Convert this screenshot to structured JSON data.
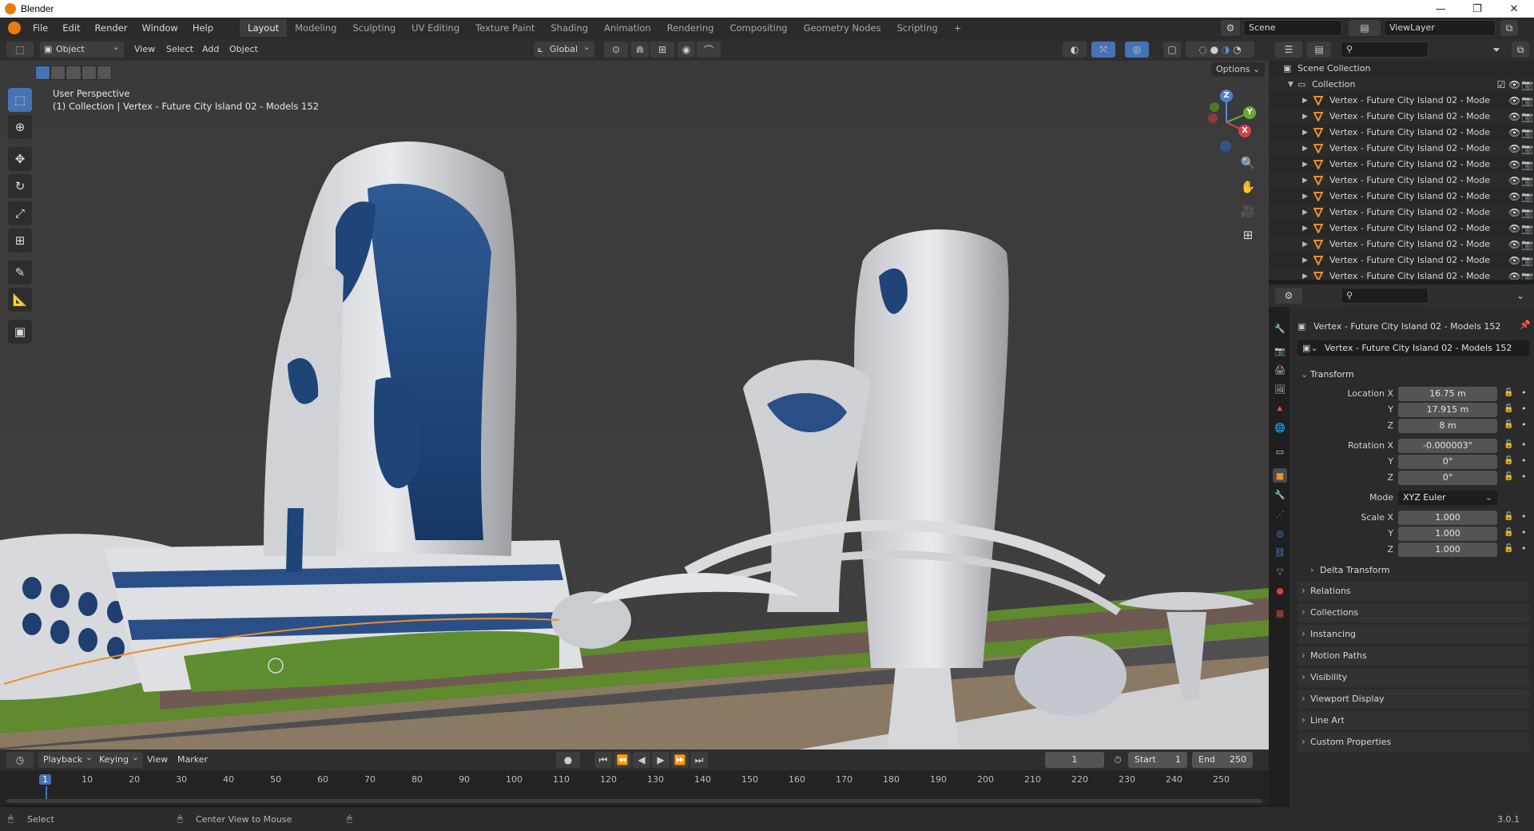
{
  "window": {
    "title": "Blender"
  },
  "menu": {
    "items": [
      "File",
      "Edit",
      "Render",
      "Window",
      "Help"
    ]
  },
  "workspaces": {
    "tabs": [
      "Layout",
      "Modeling",
      "Sculpting",
      "UV Editing",
      "Texture Paint",
      "Shading",
      "Animation",
      "Rendering",
      "Compositing",
      "Geometry Nodes",
      "Scripting"
    ],
    "active": "Layout",
    "add_label": "+"
  },
  "scene": {
    "name": "Scene",
    "view_layer": "ViewLayer"
  },
  "viewport_header": {
    "mode": "Object Mode",
    "menus": [
      "View",
      "Select",
      "Add",
      "Object"
    ],
    "orientation": "Global",
    "options_label": "Options"
  },
  "viewport": {
    "overlay_title": "User Perspective",
    "overlay_subtitle": "(1) Collection | Vertex - Future City Island 02 - Models 152",
    "gizmo": {
      "z": "Z",
      "y": "Y",
      "x": "X"
    }
  },
  "outliner": {
    "scene_collection": "Scene Collection",
    "collection": "Collection",
    "items": [
      "Vertex - Future City Island 02 - Mode",
      "Vertex - Future City Island 02 - Mode",
      "Vertex - Future City Island 02 - Mode",
      "Vertex - Future City Island 02 - Mode",
      "Vertex - Future City Island 02 - Mode",
      "Vertex - Future City Island 02 - Mode",
      "Vertex - Future City Island 02 - Mode",
      "Vertex - Future City Island 02 - Mode",
      "Vertex - Future City Island 02 - Mode",
      "Vertex - Future City Island 02 - Mode",
      "Vertex - Future City Island 02 - Mode",
      "Vertex - Future City Island 02 - Mode"
    ]
  },
  "properties": {
    "object_name": "Vertex - Future City Island 02 - Models 152",
    "object_field": "Vertex - Future City Island 02 - Models 152",
    "transform_label": "Transform",
    "location_label": "Location X",
    "y_label": "Y",
    "z_label": "Z",
    "location": {
      "x": "16.75 m",
      "y": "17.915 m",
      "z": "8 m"
    },
    "rotation_label": "Rotation X",
    "rotation": {
      "x": "-0.000003°",
      "y": "0°",
      "z": "0°"
    },
    "mode_label": "Mode",
    "mode_value": "XYZ Euler",
    "scale_label": "Scale X",
    "scale": {
      "x": "1.000",
      "y": "1.000",
      "z": "1.000"
    },
    "delta_transform": "Delta Transform",
    "panels": [
      "Relations",
      "Collections",
      "Instancing",
      "Motion Paths",
      "Visibility",
      "Viewport Display",
      "Line Art",
      "Custom Properties"
    ]
  },
  "timeline": {
    "menus": [
      "Playback",
      "Keying",
      "View",
      "Marker"
    ],
    "current_frame": "1",
    "start_label": "Start",
    "start": "1",
    "end_label": "End",
    "end": "250",
    "ticks": [
      "1",
      "10",
      "20",
      "30",
      "40",
      "50",
      "60",
      "70",
      "80",
      "90",
      "100",
      "110",
      "120",
      "130",
      "140",
      "150",
      "160",
      "170",
      "180",
      "190",
      "200",
      "210",
      "220",
      "230",
      "240",
      "250"
    ]
  },
  "status": {
    "left": "Select",
    "middle": "Center View to Mouse",
    "version": "3.0.1"
  },
  "colors": {
    "accent": "#4772b3",
    "orange": "#e87d0d",
    "viewport_bg": "#3d3d3d"
  }
}
